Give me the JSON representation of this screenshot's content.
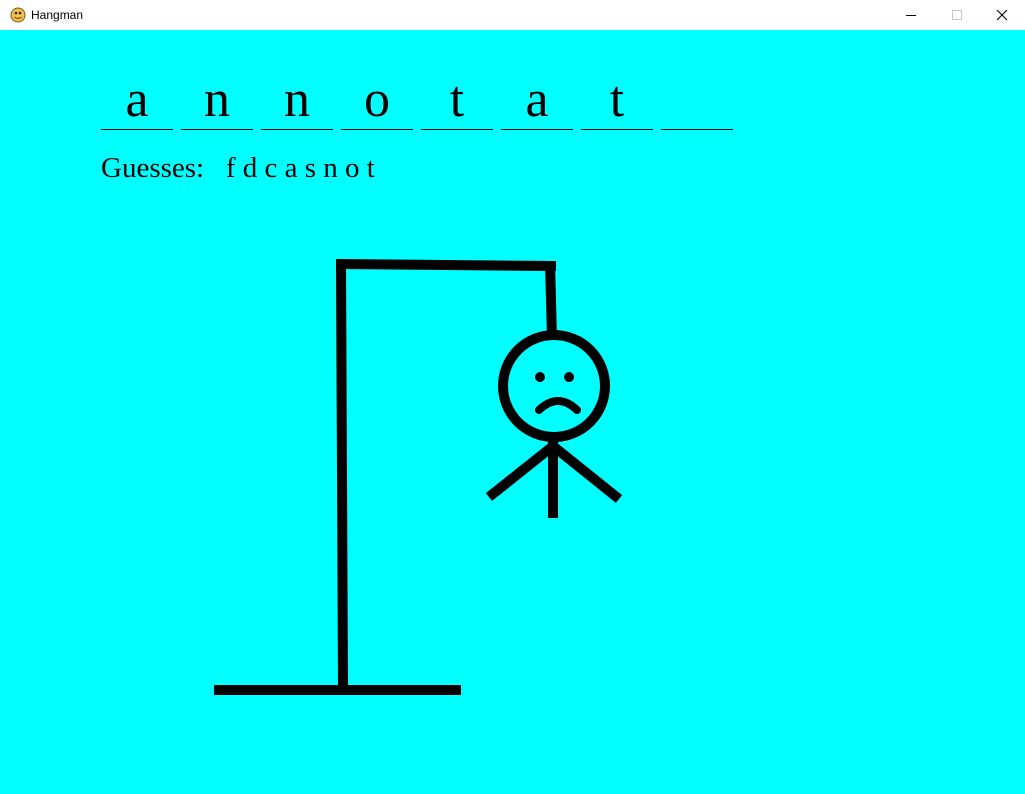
{
  "window": {
    "title": "Hangman",
    "background": "#00ffff",
    "icon": "snake-icon",
    "controls": [
      "minimize-icon",
      "maximize-icon",
      "close-icon"
    ]
  },
  "word": {
    "slots": [
      "a",
      "n",
      "n",
      "o",
      "t",
      "a",
      "t",
      ""
    ]
  },
  "guesses": {
    "label": "Guesses:",
    "letters": "f d c a s n o t"
  },
  "hangman": {
    "stroke_color": "#000000",
    "parts_drawn": [
      "base",
      "pole",
      "beam",
      "rope",
      "head",
      "face-sad",
      "body",
      "left-arm",
      "right-arm"
    ]
  }
}
